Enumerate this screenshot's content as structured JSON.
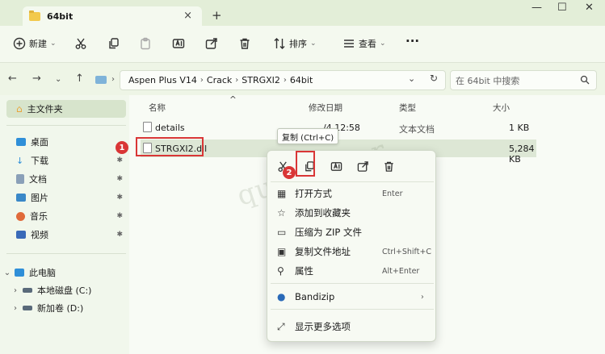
{
  "window": {
    "tab_title": "64bit",
    "close_tab": "×",
    "new_tab": "+"
  },
  "toolbar": {
    "new_label": "新建",
    "sort_label": "排序",
    "view_label": "查看",
    "more_label": "···"
  },
  "address": {
    "crumbs": [
      "Aspen Plus V14",
      "Crack",
      "STRGXI2",
      "64bit"
    ],
    "search_placeholder": "在 64bit 中搜索"
  },
  "sidebar": {
    "home": "主文件夹",
    "quick": [
      {
        "label": "桌面",
        "color": "#2f8fd8"
      },
      {
        "label": "下载",
        "color": "#2f8fd8"
      },
      {
        "label": "文档",
        "color": "#8aa0b8"
      },
      {
        "label": "图片",
        "color": "#3a88c8"
      },
      {
        "label": "音乐",
        "color": "#e06a3a"
      },
      {
        "label": "视频",
        "color": "#3a6ab8"
      }
    ],
    "this_pc": "此电脑",
    "drives": [
      "本地磁盘 (C:)",
      "新加卷 (D:)"
    ]
  },
  "file_list": {
    "columns": [
      "名称",
      "修改日期",
      "类型",
      "大小"
    ],
    "rows": [
      {
        "name": "details",
        "date": "/4 12:58",
        "type": "文本文档",
        "size": "1 KB"
      },
      {
        "name": "STRGXI2.dll",
        "date": "",
        "type": "",
        "size": "5,284 KB"
      }
    ]
  },
  "tooltip": "复制 (Ctrl+C)",
  "watermark": "queviaster",
  "context_menu": {
    "items": [
      {
        "label": "打开方式",
        "shortcut": "Enter",
        "icon": "open-with-icon"
      },
      {
        "label": "添加到收藏夹",
        "shortcut": "",
        "icon": "star-icon"
      },
      {
        "label": "压缩为 ZIP 文件",
        "shortcut": "",
        "icon": "zip-icon"
      },
      {
        "label": "复制文件地址",
        "shortcut": "Ctrl+Shift+C",
        "icon": "copy-path-icon"
      },
      {
        "label": "属性",
        "shortcut": "Alt+Enter",
        "icon": "properties-icon"
      },
      {
        "label": "Bandizip",
        "shortcut": "",
        "icon": "bandizip-icon"
      },
      {
        "label": "显示更多选项",
        "shortcut": "",
        "icon": "more-options-icon"
      }
    ]
  },
  "badges": [
    "1",
    "2"
  ],
  "colors": {
    "accent_red": "#d93636",
    "folder_yellow": "#f2c94c"
  }
}
